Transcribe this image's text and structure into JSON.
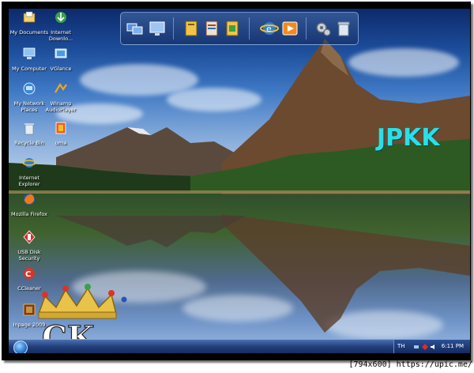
{
  "brand_text": "JPKK",
  "logo_text": "CK",
  "desktop_icons": [
    {
      "label": "My Documents",
      "icon": "folder-documents-icon"
    },
    {
      "label": "Internet Downlo...",
      "icon": "internet-download-icon"
    },
    {
      "label": "My Computer",
      "icon": "computer-icon"
    },
    {
      "label": "VGlance",
      "icon": "vglance-icon"
    },
    {
      "label": "My Network Places",
      "icon": "network-places-icon"
    },
    {
      "label": "Winamp AudioPlayer",
      "icon": "winamp-icon"
    },
    {
      "label": "Recycle Bin",
      "icon": "recycle-bin-icon"
    },
    {
      "label": "uma",
      "icon": "uma-icon"
    },
    {
      "label": "Internet Explorer",
      "icon": "internet-explorer-icon"
    },
    {
      "label": "Mozilla Firefox",
      "icon": "firefox-icon"
    },
    {
      "label": "USB Disk Security",
      "icon": "usb-disk-security-icon"
    },
    {
      "label": "CCleaner",
      "icon": "ccleaner-icon"
    },
    {
      "label": "Inpage 2009",
      "icon": "inpage-icon"
    }
  ],
  "dock_items": [
    "network-computers-icon",
    "monitor-icon",
    "folder-yellow-icon",
    "documents-icon",
    "folder-green-icon",
    "internet-explorer-icon",
    "media-player-icon",
    "settings-gears-icon",
    "recycle-bin-icon"
  ],
  "taskbar": {
    "start_icon": "windows-orb-icon",
    "language": "TH",
    "clock": "6:11 PM",
    "tray_icons": [
      "network-tray-icon",
      "antivirus-tray-icon",
      "volume-icon"
    ]
  },
  "caption": "[794x600] https://upic.me/",
  "colors": {
    "brand": "#28e0e8",
    "taskbar": "#213d7a",
    "sky_top": "#0d2a6b"
  }
}
